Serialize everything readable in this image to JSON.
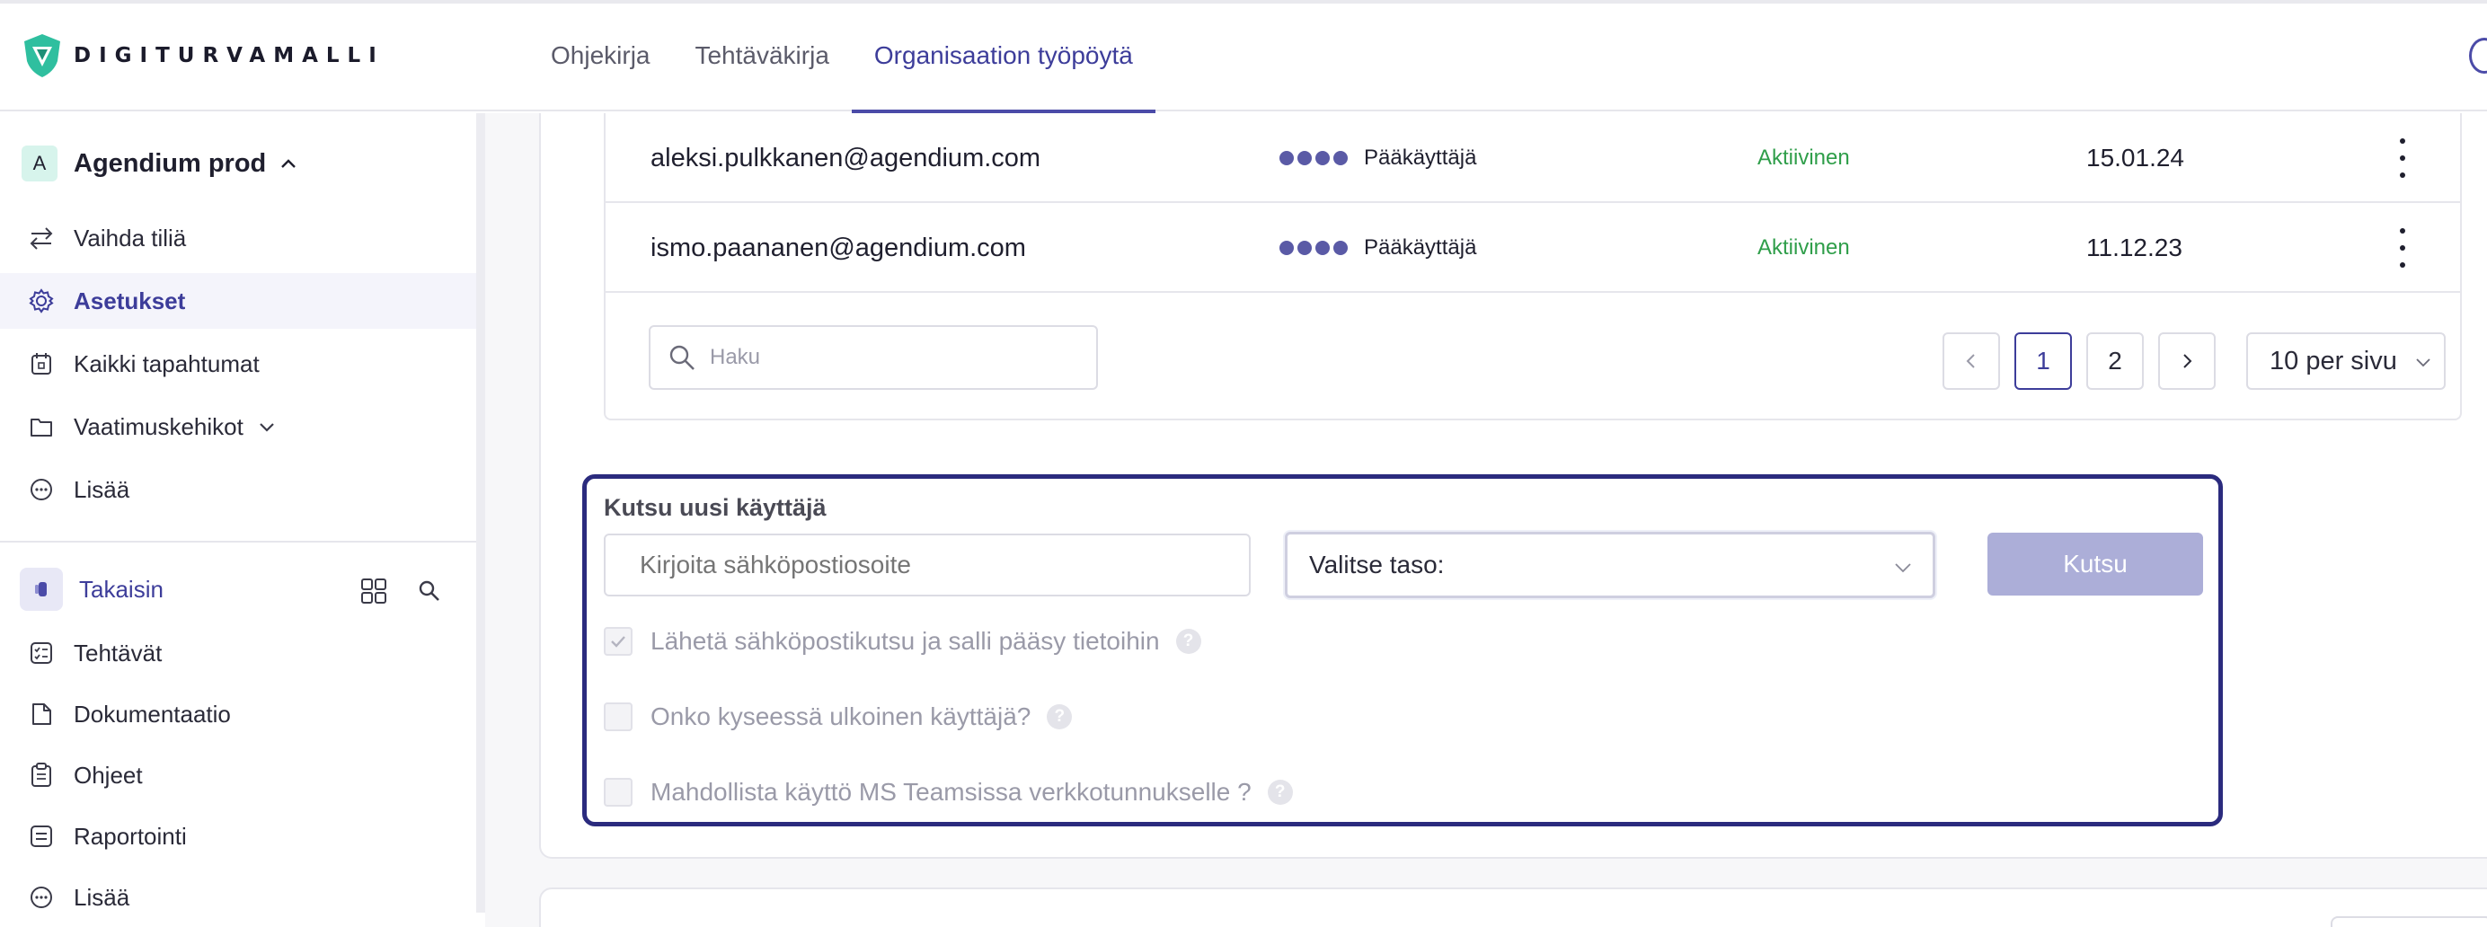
{
  "header": {
    "logo_text": "DIGITURVAMALLI",
    "tabs": [
      {
        "label": "Ohjekirja",
        "active": false
      },
      {
        "label": "Tehtäväkirja",
        "active": false
      },
      {
        "label": "Organisaation työpöytä",
        "active": true
      }
    ]
  },
  "sidebar": {
    "org": {
      "initial": "A",
      "name": "Agendium prod"
    },
    "items": [
      {
        "label": "Vaihda tiliä",
        "icon": "switch-arrows-icon"
      },
      {
        "label": "Asetukset",
        "icon": "gear-icon",
        "active": true
      },
      {
        "label": "Kaikki tapahtumat",
        "icon": "calendar-icon"
      },
      {
        "label": "Vaatimuskehikot",
        "icon": "folder-icon"
      },
      {
        "label": "Lisää",
        "icon": "more-circle-icon"
      }
    ],
    "back_label": "Takaisin",
    "sub_items": [
      {
        "label": "Tehtävät",
        "icon": "task-list-icon"
      },
      {
        "label": "Dokumentaatio",
        "icon": "document-icon"
      },
      {
        "label": "Ohjeet",
        "icon": "clipboard-icon"
      },
      {
        "label": "Raportointi",
        "icon": "report-icon"
      },
      {
        "label": "Lisää",
        "icon": "more-circle-icon"
      }
    ]
  },
  "users": {
    "rows": [
      {
        "email": "aleksi.pulkkanen@agendium.com",
        "role": "Pääkäyttäjä",
        "status": "Aktiivinen",
        "date": "15.01.24"
      },
      {
        "email": "ismo.paananen@agendium.com",
        "role": "Pääkäyttäjä",
        "status": "Aktiivinen",
        "date": "11.12.23"
      }
    ],
    "search_placeholder": "Haku",
    "pagination": {
      "prev": "<",
      "pages": [
        "1",
        "2"
      ],
      "current": "1",
      "next": ">",
      "per_page": "10 per sivu"
    }
  },
  "invite": {
    "title": "Kutsu uusi käyttäjä",
    "email_placeholder": "Kirjoita sähköpostiosoite",
    "level_placeholder": "Valitse taso:",
    "button": "Kutsu",
    "options": [
      {
        "label": "Lähetä sähköpostikutsu ja salli pääsy tietoihin",
        "checked": true
      },
      {
        "label": "Onko kyseessä ulkoinen käyttäjä?",
        "checked": false
      },
      {
        "label": "Mahdollista käyttö MS Teamsissa verkkotunnukselle ?",
        "checked": false
      }
    ],
    "help_glyph": "?"
  },
  "colors": {
    "accent": "#3d3d9a",
    "invite_border": "#2b2b7e",
    "status_active": "#2f9e4a",
    "button_disabled": "#acaed8",
    "logo_green": "#2fbf9f"
  }
}
